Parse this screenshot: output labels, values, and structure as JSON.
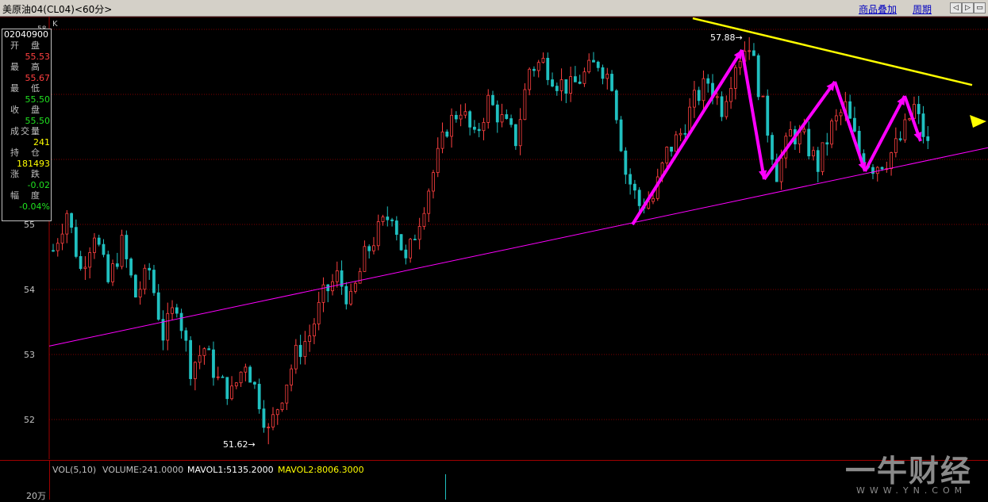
{
  "titlebar": {
    "title": "美原油04(CL04)<60分>",
    "overlay_link": "商品叠加",
    "period_link": "周期",
    "buttons": [
      "◁",
      "▷",
      "▭",
      "▣"
    ]
  },
  "chart_label": "K",
  "infobox": {
    "date": "02040900",
    "rows": [
      {
        "label": "开　盘",
        "value": "55.53",
        "color": "#ff4040"
      },
      {
        "label": "最　高",
        "value": "55.67",
        "color": "#ff4040"
      },
      {
        "label": "最　低",
        "value": "55.50",
        "color": "#20e020"
      },
      {
        "label": "收　盘",
        "value": "55.50",
        "color": "#20e020"
      },
      {
        "label": "成交量",
        "value": "241",
        "color": "#ffff00"
      },
      {
        "label": "持　仓",
        "value": "181493",
        "color": "#ffff00"
      },
      {
        "label": "涨　跌",
        "value": "-0.02",
        "color": "#20e020"
      },
      {
        "label": "幅　度",
        "value": "-0.04%",
        "color": "#20e020"
      }
    ]
  },
  "volume_bar": {
    "label1": "VOL(5,10)",
    "label2": "VOLUME:241.0000",
    "label3": "MAVOL1:5135.2000",
    "label4": "MAVOL2:8006.3000",
    "axis_label": "20万"
  },
  "watermark": {
    "big": "一牛财经",
    "small": "WWW.YN.COM"
  },
  "colors": {
    "up": "#ff4040",
    "down": "#20c0c0",
    "grid": "#800000",
    "axis": "#c0c0c0",
    "support": "#ff00ff",
    "resistance": "#ffff00",
    "arrow": "#ff00ff"
  },
  "chart_data": {
    "type": "candlestick",
    "title": "美原油04(CL04)<60分>",
    "ylim": [
      51.4,
      58.2
    ],
    "yticks": [
      52,
      53,
      54,
      55
    ],
    "y_top_partial": "58",
    "annotations": [
      {
        "text": "57.88",
        "price": 57.88,
        "kind": "high"
      },
      {
        "text": "51.62",
        "price": 51.62,
        "kind": "low"
      }
    ],
    "trendlines": [
      {
        "name": "support",
        "from_price": 53.13,
        "to_price": 56.18
      },
      {
        "name": "resistance",
        "from_price": 58.17,
        "to_price": 57.12
      }
    ],
    "price_path": [
      [
        0,
        54.6
      ],
      [
        3,
        55.2
      ],
      [
        6,
        54.3
      ],
      [
        9,
        54.9
      ],
      [
        12,
        54.1
      ],
      [
        15,
        54.7
      ],
      [
        18,
        53.9
      ],
      [
        21,
        54.3
      ],
      [
        24,
        53.3
      ],
      [
        27,
        53.8
      ],
      [
        30,
        52.8
      ],
      [
        33,
        53.1
      ],
      [
        36,
        52.6
      ],
      [
        39,
        52.4
      ],
      [
        42,
        52.9
      ],
      [
        45,
        52.3
      ],
      [
        47,
        51.8
      ],
      [
        50,
        52.4
      ],
      [
        53,
        53.0
      ],
      [
        56,
        53.3
      ],
      [
        59,
        53.9
      ],
      [
        62,
        54.2
      ],
      [
        65,
        53.8
      ],
      [
        68,
        54.5
      ],
      [
        71,
        54.9
      ],
      [
        74,
        55.2
      ],
      [
        77,
        54.4
      ],
      [
        80,
        55.1
      ],
      [
        83,
        55.8
      ],
      [
        86,
        56.5
      ],
      [
        89,
        56.8
      ],
      [
        92,
        56.3
      ],
      [
        95,
        56.9
      ],
      [
        98,
        56.6
      ],
      [
        101,
        56.3
      ],
      [
        104,
        57.4
      ],
      [
        107,
        57.5
      ],
      [
        110,
        57.2
      ],
      [
        113,
        57.1
      ],
      [
        116,
        57.3
      ],
      [
        119,
        57.5
      ],
      [
        122,
        57.2
      ],
      [
        125,
        55.8
      ],
      [
        128,
        55.3
      ],
      [
        131,
        55.4
      ],
      [
        134,
        56.1
      ],
      [
        137,
        56.4
      ],
      [
        140,
        56.9
      ],
      [
        143,
        57.2
      ],
      [
        146,
        56.8
      ],
      [
        149,
        57.5
      ],
      [
        152,
        57.8
      ],
      [
        155,
        56.8
      ],
      [
        158,
        55.8
      ],
      [
        161,
        56.4
      ],
      [
        164,
        56.3
      ],
      [
        167,
        55.9
      ],
      [
        170,
        56.5
      ],
      [
        173,
        56.8
      ],
      [
        176,
        56.1
      ],
      [
        179,
        55.9
      ],
      [
        182,
        56.0
      ],
      [
        185,
        56.3
      ],
      [
        188,
        56.8
      ],
      [
        191,
        56.2
      ]
    ],
    "volume_spike_index": 84
  }
}
